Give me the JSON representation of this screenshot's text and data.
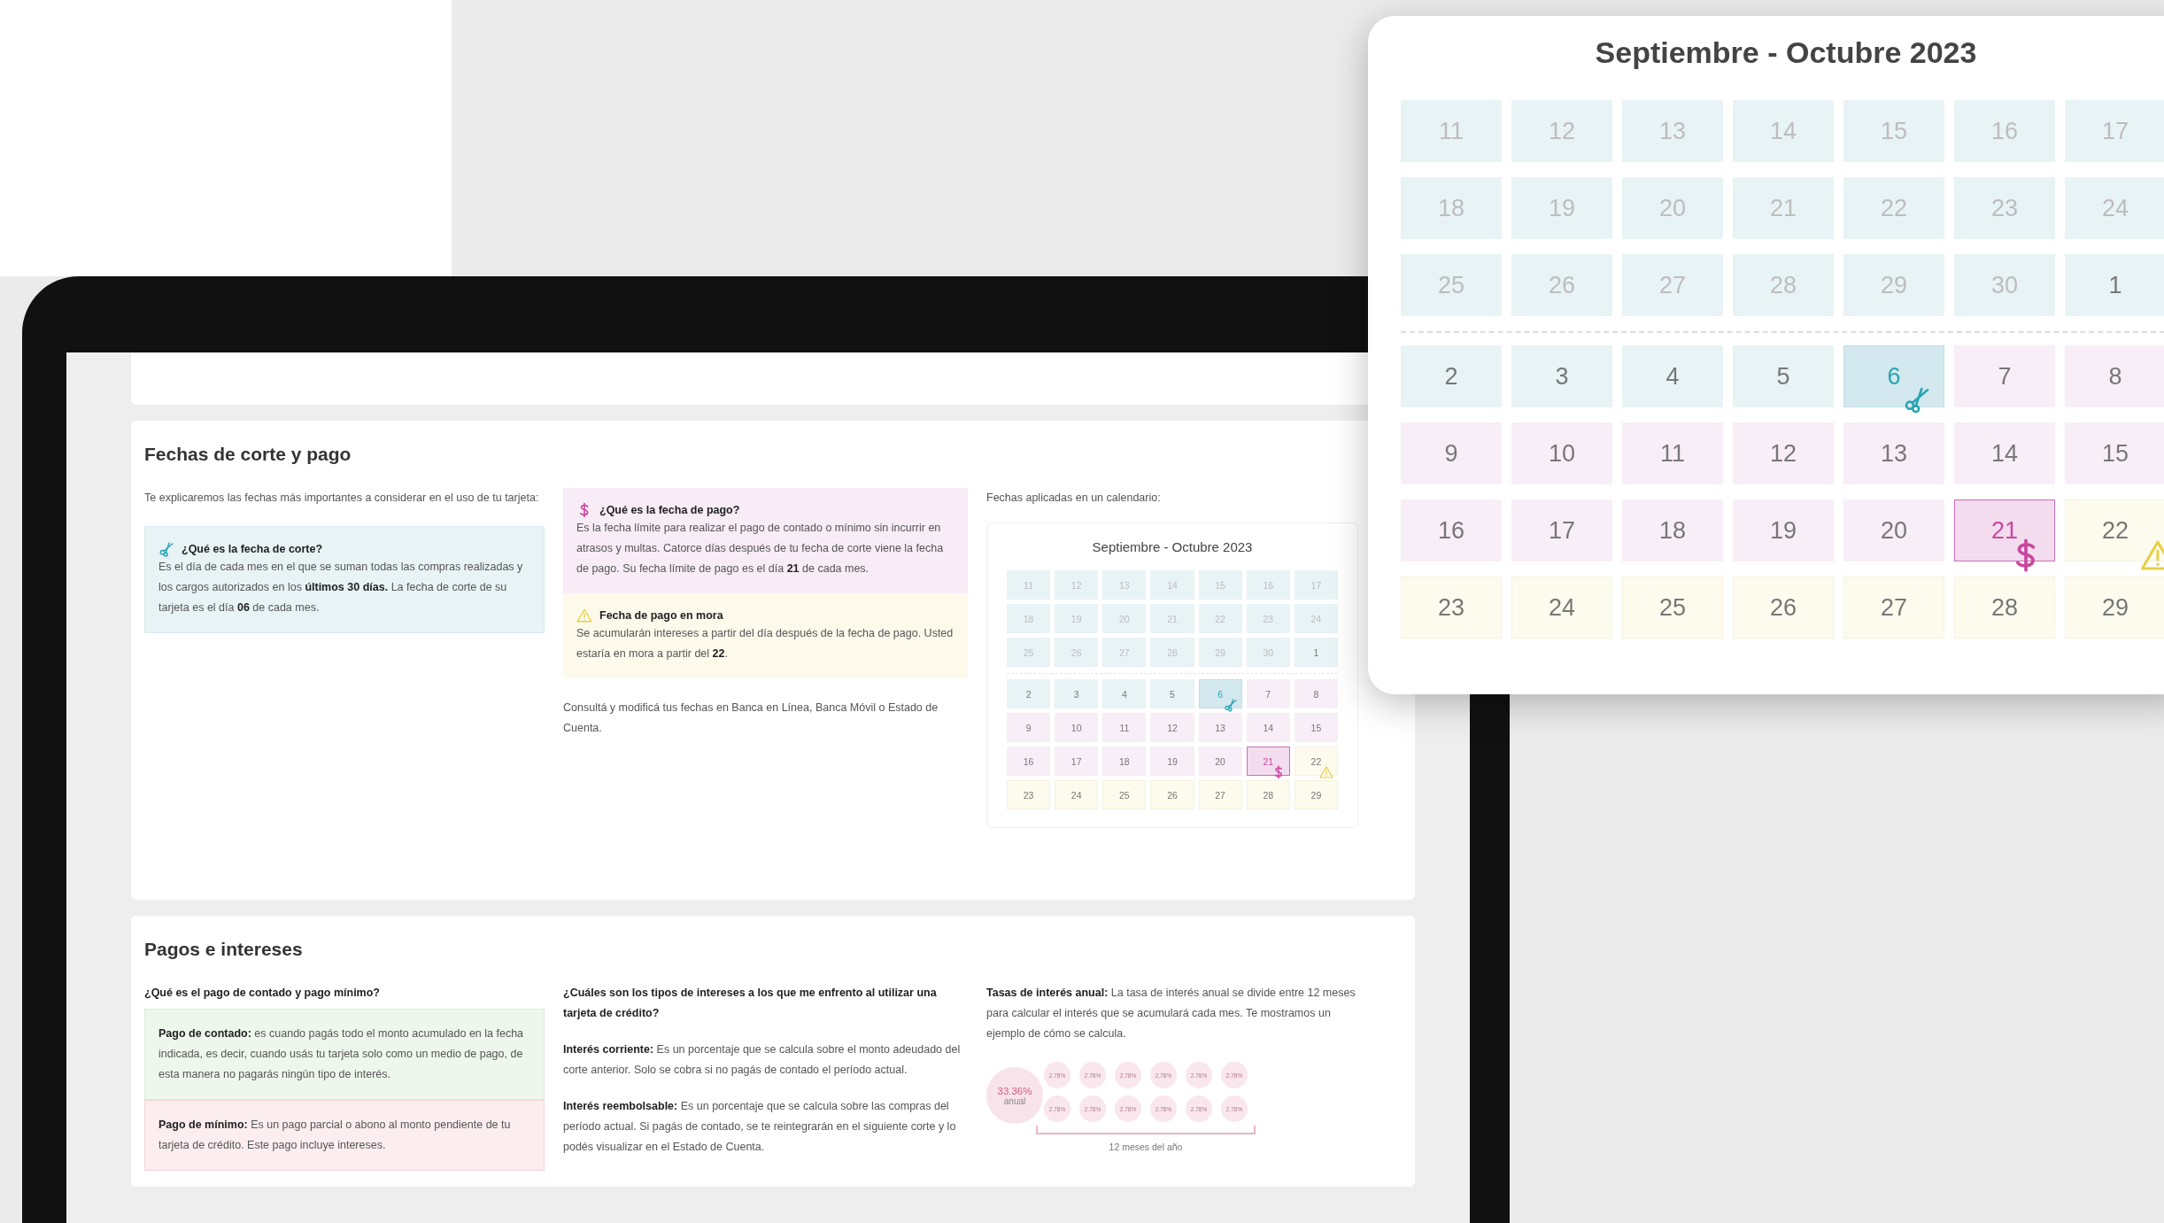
{
  "dates_card": {
    "title": "Fechas de corte y pago",
    "intro": "Te explicaremos las fechas más importantes a considerar en el uso de tu tarjeta:",
    "left_boxes": [
      {
        "kind": "cut",
        "title": "¿Qué es la fecha de corte?",
        "text": "Es el día de cada mes en el que se suman todas las compras realizadas y los cargos autorizados en los **últimos 30 días.**  La fecha de corte de su tarjeta es el día **06** de cada mes."
      }
    ],
    "middle_boxes": [
      {
        "kind": "payment",
        "title": "¿Qué es la fecha de pago?",
        "text": "Es la fecha límite para realizar el pago de contado o mínimo sin incurrir en atrasos y multas. Catorce días después de tu fecha de corte viene la fecha de pago. Su fecha límite de pago es el día **21** de cada mes."
      },
      {
        "kind": "late",
        "title": "Fecha de pago en mora",
        "text": "Se acumularán intereses a partir del día después de la fecha de pago. Usted estaría en mora a partir del **22**."
      }
    ],
    "note": "Consultá y modificá tus fechas en Banca en Línea, Banca Móvil o Estado de Cuenta.",
    "calendar_label": "Fechas aplicadas en un calendario:",
    "calendar": {
      "title": "Septiembre - Octubre 2023",
      "weeks": [
        {
          "divider_before": false,
          "days": [
            {
              "day": "11",
              "kind": "cycle",
              "muted": true
            },
            {
              "day": "12",
              "kind": "cycle",
              "muted": true
            },
            {
              "day": "13",
              "kind": "cycle",
              "muted": true
            },
            {
              "day": "14",
              "kind": "cycle",
              "muted": true
            },
            {
              "day": "15",
              "kind": "cycle",
              "muted": true
            },
            {
              "day": "16",
              "kind": "cycle",
              "muted": true
            },
            {
              "day": "17",
              "kind": "cycle",
              "muted": true
            }
          ]
        },
        {
          "divider_before": false,
          "days": [
            {
              "day": "18",
              "kind": "cycle",
              "muted": true
            },
            {
              "day": "19",
              "kind": "cycle",
              "muted": true
            },
            {
              "day": "20",
              "kind": "cycle",
              "muted": true
            },
            {
              "day": "21",
              "kind": "cycle",
              "muted": true
            },
            {
              "day": "22",
              "kind": "cycle",
              "muted": true
            },
            {
              "day": "23",
              "kind": "cycle",
              "muted": true
            },
            {
              "day": "24",
              "kind": "cycle",
              "muted": true
            }
          ]
        },
        {
          "divider_before": false,
          "days": [
            {
              "day": "25",
              "kind": "cycle",
              "muted": true
            },
            {
              "day": "26",
              "kind": "cycle",
              "muted": true
            },
            {
              "day": "27",
              "kind": "cycle",
              "muted": true
            },
            {
              "day": "28",
              "kind": "cycle",
              "muted": true
            },
            {
              "day": "29",
              "kind": "cycle",
              "muted": true
            },
            {
              "day": "30",
              "kind": "cycle",
              "muted": true
            },
            {
              "day": "1",
              "kind": "cycle",
              "muted": false
            }
          ]
        },
        {
          "divider_before": true,
          "days": [
            {
              "day": "2",
              "kind": "cycle",
              "muted": false
            },
            {
              "day": "3",
              "kind": "cycle",
              "muted": false
            },
            {
              "day": "4",
              "kind": "cycle",
              "muted": false
            },
            {
              "day": "5",
              "kind": "cycle",
              "muted": false
            },
            {
              "day": "6",
              "kind": "cut_day",
              "muted": false
            },
            {
              "day": "7",
              "kind": "grace",
              "muted": false
            },
            {
              "day": "8",
              "kind": "grace",
              "muted": false
            }
          ]
        },
        {
          "divider_before": false,
          "days": [
            {
              "day": "9",
              "kind": "grace",
              "muted": false
            },
            {
              "day": "10",
              "kind": "grace",
              "muted": false
            },
            {
              "day": "11",
              "kind": "grace",
              "muted": false
            },
            {
              "day": "12",
              "kind": "grace",
              "muted": false
            },
            {
              "day": "13",
              "kind": "grace",
              "muted": false
            },
            {
              "day": "14",
              "kind": "grace",
              "muted": false
            },
            {
              "day": "15",
              "kind": "grace",
              "muted": false
            }
          ]
        },
        {
          "divider_before": false,
          "days": [
            {
              "day": "16",
              "kind": "grace",
              "muted": false
            },
            {
              "day": "17",
              "kind": "grace",
              "muted": false
            },
            {
              "day": "18",
              "kind": "grace",
              "muted": false
            },
            {
              "day": "19",
              "kind": "grace",
              "muted": false
            },
            {
              "day": "20",
              "kind": "grace",
              "muted": false
            },
            {
              "day": "21",
              "kind": "due_day",
              "muted": false
            },
            {
              "day": "22",
              "kind": "late_start",
              "muted": false
            }
          ]
        },
        {
          "divider_before": false,
          "days": [
            {
              "day": "23",
              "kind": "late",
              "muted": false
            },
            {
              "day": "24",
              "kind": "late",
              "muted": false
            },
            {
              "day": "25",
              "kind": "late",
              "muted": false
            },
            {
              "day": "26",
              "kind": "late",
              "muted": false
            },
            {
              "day": "27",
              "kind": "late",
              "muted": false
            },
            {
              "day": "28",
              "kind": "late",
              "muted": false
            },
            {
              "day": "29",
              "kind": "late",
              "muted": false
            }
          ]
        }
      ]
    }
  },
  "payments_card": {
    "title": "Pagos e intereses",
    "left": {
      "heading": "¿Qué es el pago de contado y pago mínimo?",
      "boxes": [
        {
          "kind": "cash",
          "text": "**Pago de contado:** es cuando pagás todo el monto acumulado en la fecha indicada, es decir, cuando usás tu tarjeta solo como un medio de pago, de esta manera no pagarás ningún tipo de interés."
        },
        {
          "kind": "minimum",
          "text": "**Pago de mínimo:** Es un pago parcial o abono al monto pendiente de tu tarjeta de crédito. Este pago incluye intereses."
        }
      ]
    },
    "middle": {
      "heading": "¿Cuáles son los tipos de intereses a los que me enfrento al utilizar una tarjeta de crédito?",
      "paragraphs": [
        "**Interés corriente:** Es un porcentaje que se calcula sobre el monto adeudado del corte anterior. Solo se cobra si no pagás de contado el período actual.",
        "**Interés reembolsable:** Es un porcentaje que se calcula sobre las compras del período actual. Si pagás de contado, se te reintegrarán en el siguiente corte y lo podés visualizar en el Estado de Cuenta."
      ]
    },
    "right": {
      "text": "**Tasas de interés anual:** La tasa de interés anual se divide entre 12 meses para calcular el interés que se acumulará cada mes. Te mostramos un ejemplo de cómo se calcula.",
      "annual_rate": {
        "value": "33.36%",
        "label": "anual"
      },
      "monthly_rates": [
        "2.78%",
        "2.78%",
        "2.78%",
        "2.78%",
        "2.78%",
        "2.78%",
        "2.78%",
        "2.78%",
        "2.78%",
        "2.78%",
        "2.78%",
        "2.78%"
      ],
      "span_label": "12 meses del año"
    }
  },
  "calendar_popup": {
    "title": "Septiembre - Octubre 2023",
    "weeks": [
      {
        "divider_before": false,
        "days": [
          {
            "day": "11",
            "kind": "cycle",
            "muted": true
          },
          {
            "day": "12",
            "kind": "cycle",
            "muted": true
          },
          {
            "day": "13",
            "kind": "cycle",
            "muted": true
          },
          {
            "day": "14",
            "kind": "cycle",
            "muted": true
          },
          {
            "day": "15",
            "kind": "cycle",
            "muted": true
          },
          {
            "day": "16",
            "kind": "cycle",
            "muted": true
          },
          {
            "day": "17",
            "kind": "cycle",
            "muted": true
          }
        ]
      },
      {
        "divider_before": false,
        "days": [
          {
            "day": "18",
            "kind": "cycle",
            "muted": true
          },
          {
            "day": "19",
            "kind": "cycle",
            "muted": true
          },
          {
            "day": "20",
            "kind": "cycle",
            "muted": true
          },
          {
            "day": "21",
            "kind": "cycle",
            "muted": true
          },
          {
            "day": "22",
            "kind": "cycle",
            "muted": true
          },
          {
            "day": "23",
            "kind": "cycle",
            "muted": true
          },
          {
            "day": "24",
            "kind": "cycle",
            "muted": true
          }
        ]
      },
      {
        "divider_before": false,
        "days": [
          {
            "day": "25",
            "kind": "cycle",
            "muted": true
          },
          {
            "day": "26",
            "kind": "cycle",
            "muted": true
          },
          {
            "day": "27",
            "kind": "cycle",
            "muted": true
          },
          {
            "day": "28",
            "kind": "cycle",
            "muted": true
          },
          {
            "day": "29",
            "kind": "cycle",
            "muted": true
          },
          {
            "day": "30",
            "kind": "cycle",
            "muted": true
          },
          {
            "day": "1",
            "kind": "cycle",
            "muted": false
          }
        ]
      },
      {
        "divider_before": true,
        "days": [
          {
            "day": "2",
            "kind": "cycle",
            "muted": false
          },
          {
            "day": "3",
            "kind": "cycle",
            "muted": false
          },
          {
            "day": "4",
            "kind": "cycle",
            "muted": false
          },
          {
            "day": "5",
            "kind": "cycle",
            "muted": false
          },
          {
            "day": "6",
            "kind": "cut_day",
            "muted": false
          },
          {
            "day": "7",
            "kind": "grace",
            "muted": false
          },
          {
            "day": "8",
            "kind": "grace",
            "muted": false
          }
        ]
      },
      {
        "divider_before": false,
        "days": [
          {
            "day": "9",
            "kind": "grace",
            "muted": false
          },
          {
            "day": "10",
            "kind": "grace",
            "muted": false
          },
          {
            "day": "11",
            "kind": "grace",
            "muted": false
          },
          {
            "day": "12",
            "kind": "grace",
            "muted": false
          },
          {
            "day": "13",
            "kind": "grace",
            "muted": false
          },
          {
            "day": "14",
            "kind": "grace",
            "muted": false
          },
          {
            "day": "15",
            "kind": "grace",
            "muted": false
          }
        ]
      },
      {
        "divider_before": false,
        "days": [
          {
            "day": "16",
            "kind": "grace",
            "muted": false
          },
          {
            "day": "17",
            "kind": "grace",
            "muted": false
          },
          {
            "day": "18",
            "kind": "grace",
            "muted": false
          },
          {
            "day": "19",
            "kind": "grace",
            "muted": false
          },
          {
            "day": "20",
            "kind": "grace",
            "muted": false
          },
          {
            "day": "21",
            "kind": "due_day",
            "muted": false
          },
          {
            "day": "22",
            "kind": "late_start",
            "muted": false
          }
        ]
      },
      {
        "divider_before": false,
        "days": [
          {
            "day": "23",
            "kind": "late",
            "muted": false
          },
          {
            "day": "24",
            "kind": "late",
            "muted": false
          },
          {
            "day": "25",
            "kind": "late",
            "muted": false
          },
          {
            "day": "26",
            "kind": "late",
            "muted": false
          },
          {
            "day": "27",
            "kind": "late",
            "muted": false
          },
          {
            "day": "28",
            "kind": "late",
            "muted": false
          },
          {
            "day": "29",
            "kind": "late",
            "muted": false
          }
        ]
      }
    ]
  }
}
